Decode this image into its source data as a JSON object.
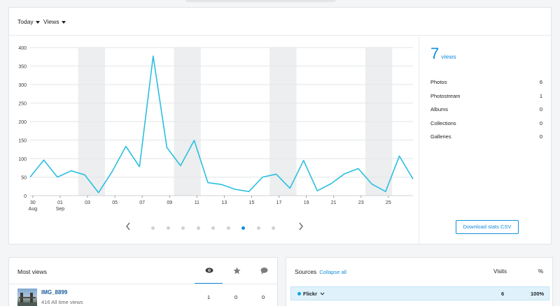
{
  "filters": {
    "period_label": "Today",
    "metric_label": "Views"
  },
  "chart_data": {
    "type": "line",
    "title": "",
    "xlabel": "",
    "ylabel": "",
    "ylim": [
      0,
      400
    ],
    "yticks": [
      "0",
      "50",
      "100",
      "150",
      "200",
      "250",
      "300",
      "350",
      "400"
    ],
    "x": [
      "30 Aug",
      "31 Aug",
      "01 Sep",
      "02 Sep",
      "03 Sep",
      "04 Sep",
      "05 Sep",
      "06 Sep",
      "07 Sep",
      "08 Sep",
      "09 Sep",
      "10 Sep",
      "11 Sep",
      "12 Sep",
      "13 Sep",
      "14 Sep",
      "15 Sep",
      "16 Sep",
      "17 Sep",
      "18 Sep",
      "19 Sep",
      "20 Sep",
      "21 Sep",
      "22 Sep",
      "23 Sep",
      "24 Sep",
      "25 Sep",
      "26 Sep"
    ],
    "xtick_labels": [
      {
        "day": "30",
        "month": "Aug"
      },
      {
        "day": "01",
        "month": "Sep"
      },
      {
        "day": "03",
        "month": ""
      },
      {
        "day": "05",
        "month": ""
      },
      {
        "day": "07",
        "month": ""
      },
      {
        "day": "09",
        "month": ""
      },
      {
        "day": "11",
        "month": ""
      },
      {
        "day": "13",
        "month": ""
      },
      {
        "day": "15",
        "month": ""
      },
      {
        "day": "17",
        "month": ""
      },
      {
        "day": "19",
        "month": ""
      },
      {
        "day": "21",
        "month": ""
      },
      {
        "day": "23",
        "month": ""
      },
      {
        "day": "25",
        "month": ""
      }
    ],
    "series": [
      {
        "values": [
          50,
          96,
          50,
          67,
          56,
          8,
          65,
          133,
          78,
          377,
          130,
          81,
          149,
          35,
          30,
          17,
          11,
          50,
          58,
          20,
          95,
          13,
          32,
          59,
          73,
          31,
          11,
          107,
          45
        ]
      }
    ],
    "weekend_bands": [
      "02 Sep–03 Sep",
      "09 Sep–10 Sep",
      "16 Sep–17 Sep",
      "23 Sep–24 Sep"
    ],
    "grid": true,
    "color": "#2bbfdf"
  },
  "pager": {
    "prev_icon": "chevron-left-icon",
    "next_icon": "chevron-right-icon",
    "page_count": 9,
    "active_page": 7
  },
  "stats": {
    "total_value": "7",
    "total_label": "views",
    "rows": [
      {
        "label": "Photos",
        "value": "6"
      },
      {
        "label": "Photostream",
        "value": "1"
      },
      {
        "label": "Albums",
        "value": "0"
      },
      {
        "label": "Collections",
        "value": "0"
      },
      {
        "label": "Galleries",
        "value": "0"
      }
    ],
    "download_label": "Download stats CSV"
  },
  "most_views": {
    "title": "Most views",
    "tabs": [
      "eye-icon",
      "star-icon",
      "comment-icon"
    ],
    "rows": [
      {
        "title": "IMG_8899",
        "subtitle": "416 All time views",
        "views": "1",
        "faves": "0",
        "comments": "0"
      }
    ]
  },
  "sources": {
    "title": "Sources",
    "collapse_label": "Collapse all",
    "visits_header": "Visits",
    "pct_header": "%",
    "rows": [
      {
        "name": "Flickr",
        "visits": "6",
        "pct": "100%"
      }
    ]
  },
  "colors": {
    "accent": "#128fdc",
    "line": "#2bbfdf",
    "band": "#eceef0",
    "source_row": "#dff2fb"
  }
}
